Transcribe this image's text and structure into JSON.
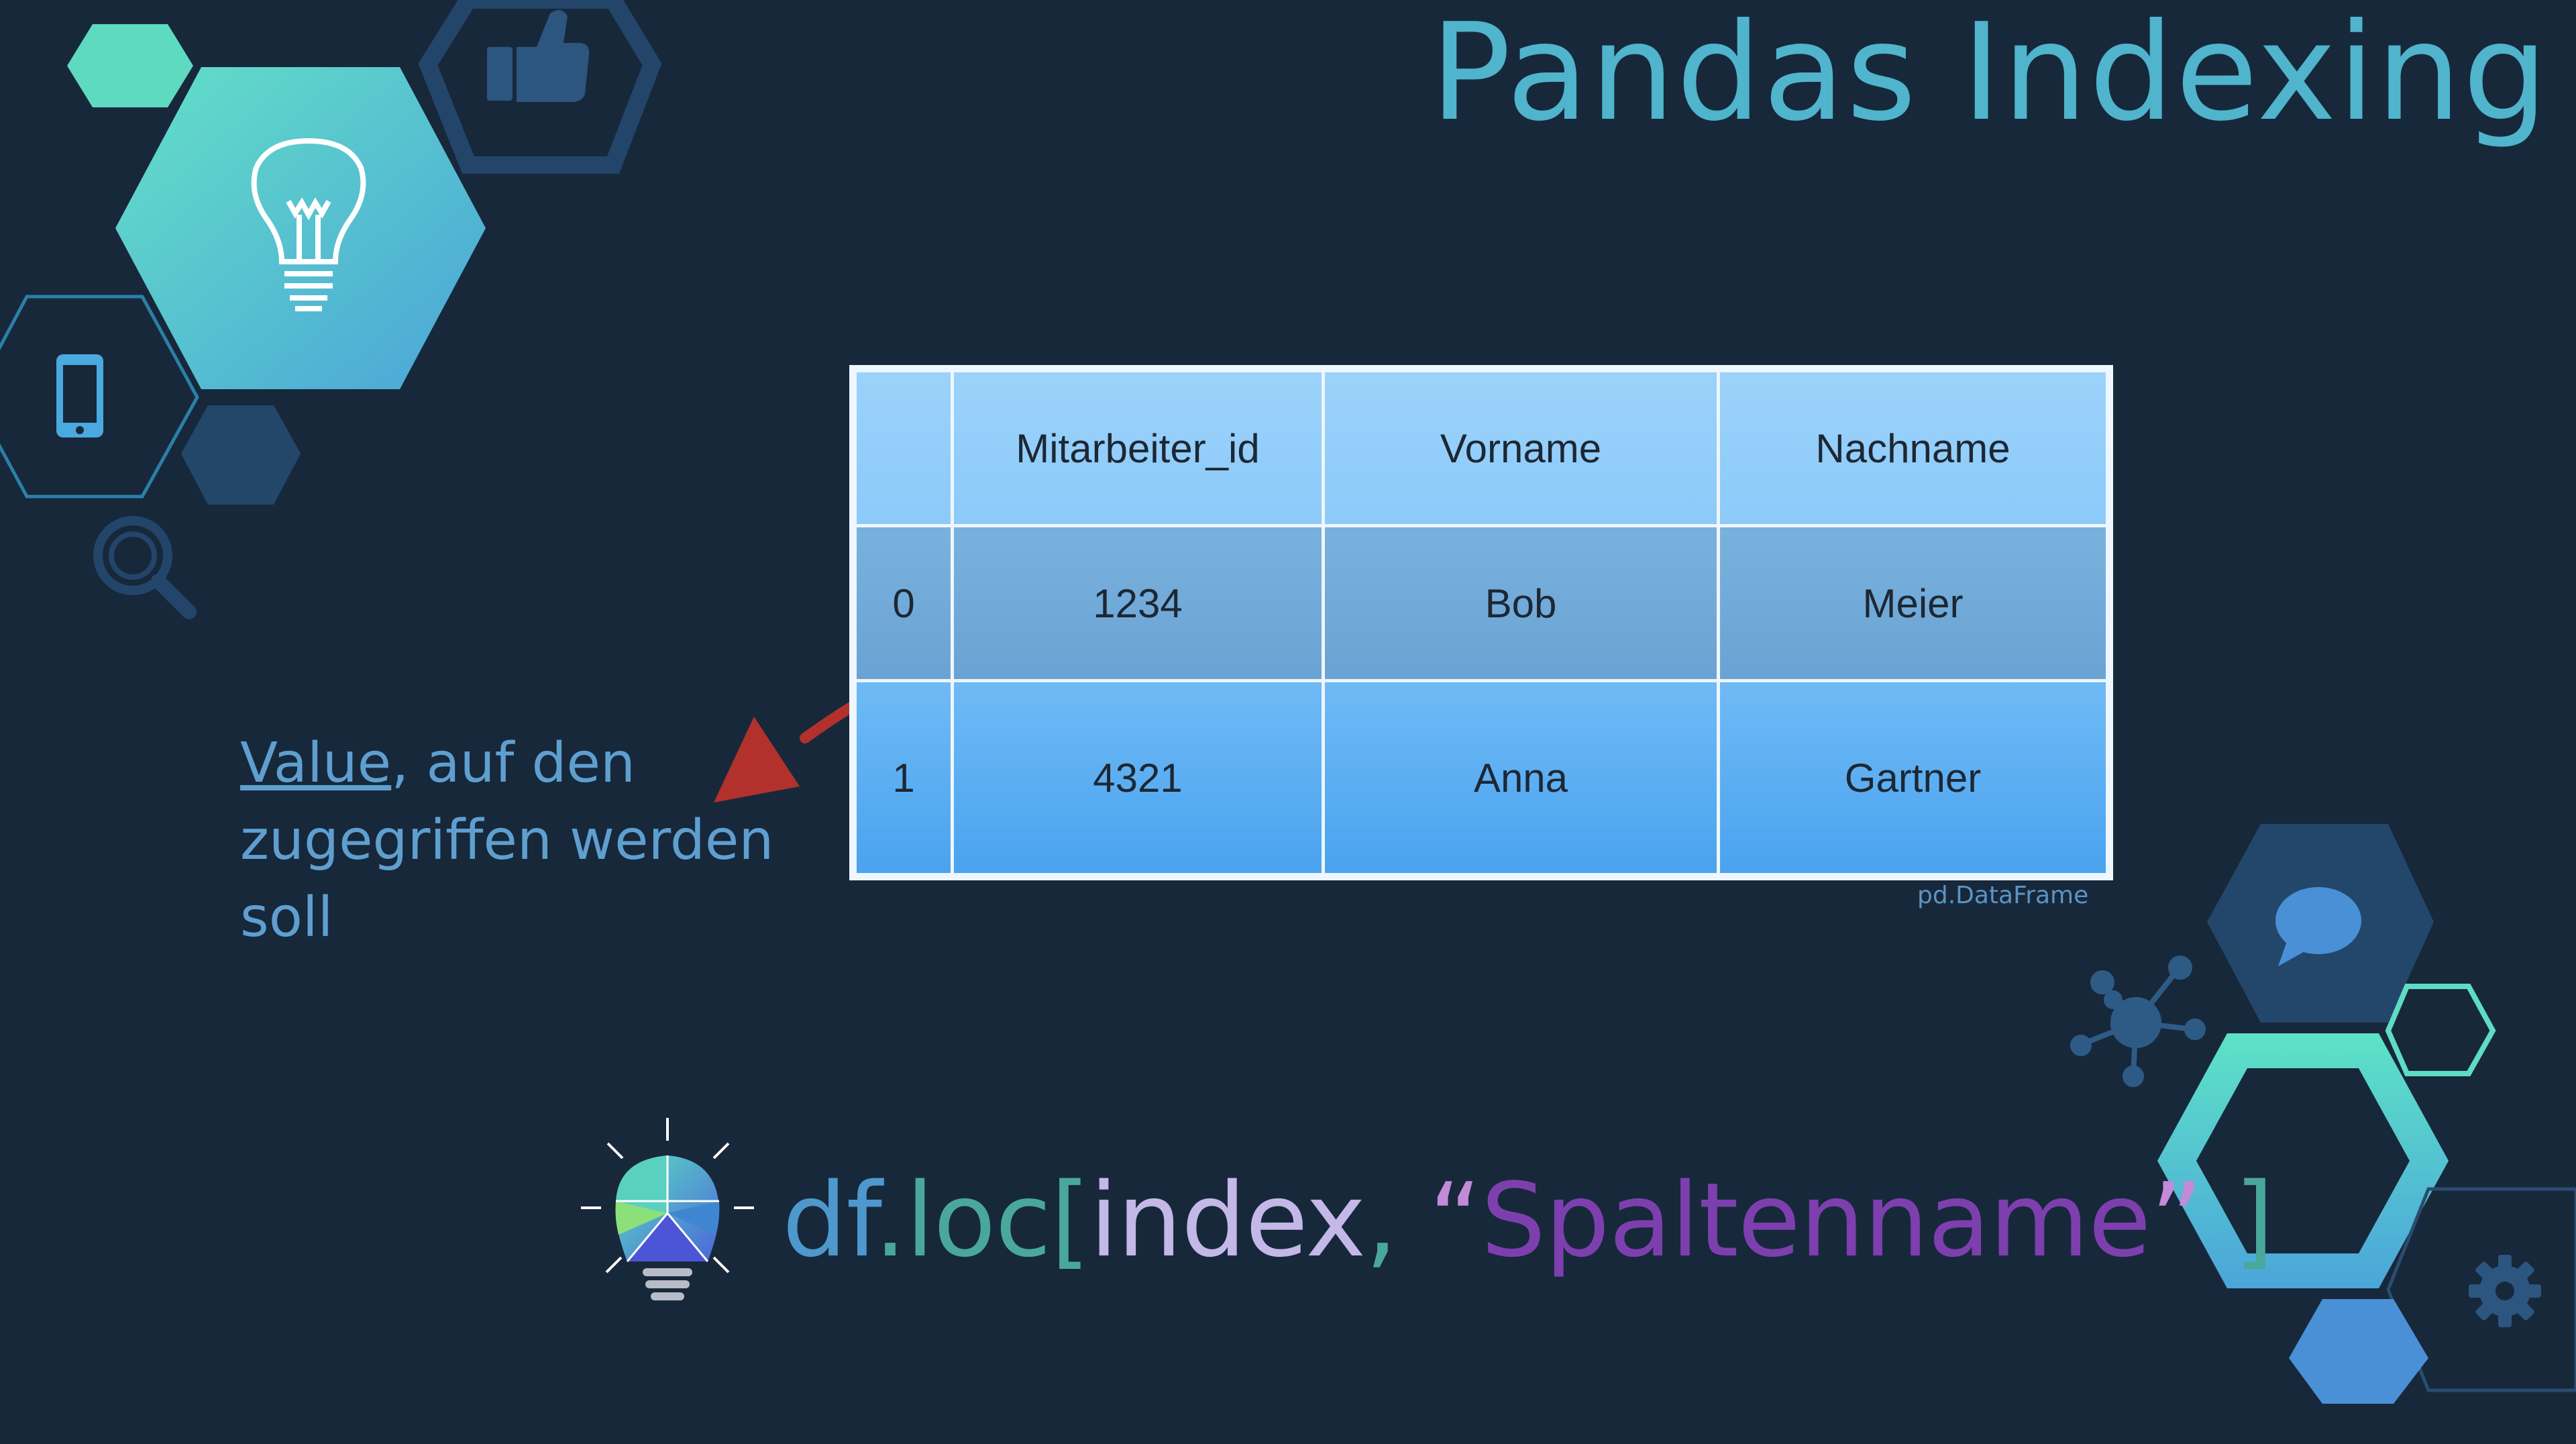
{
  "title": "Pandas Indexing",
  "table": {
    "headers": [
      "",
      "Mitarbeiter_id",
      "Vorname",
      "Nachname"
    ],
    "rows": [
      [
        "0",
        "1234",
        "Bob",
        "Meier"
      ],
      [
        "1",
        "4321",
        "Anna",
        "Gartner"
      ]
    ],
    "caption": "pd.DataFrame"
  },
  "annotation": {
    "underlined": "Value",
    "rest": ", auf den zugegriffen werden soll"
  },
  "code": {
    "df": "df",
    "dot_loc": ".loc",
    "open_bracket": "[",
    "index": "index",
    "comma": ",",
    "open_quote": " “",
    "colname": "Spaltenname",
    "close_quote": "” ",
    "close_bracket": "]"
  },
  "icons": [
    "lightbulb-icon",
    "thumbs-up-icon",
    "smartphone-icon",
    "magnifier-icon",
    "chat-bubble-icon",
    "network-icon",
    "gear-icon",
    "colorful-lightbulb-icon"
  ],
  "colors": {
    "background": "#17283b",
    "title": "#4fb4cc",
    "teal": "#5fdcc4",
    "arrow": "#b2312c"
  }
}
